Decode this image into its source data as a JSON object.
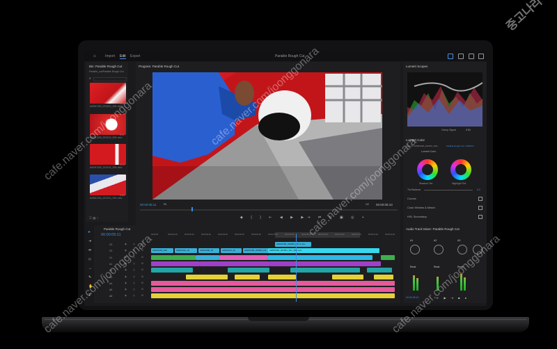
{
  "app": {
    "title": "Parable Rough Cut",
    "tabs": [
      {
        "label": "Import",
        "active": false
      },
      {
        "label": "Edit",
        "active": true
      },
      {
        "label": "Export",
        "active": false
      }
    ]
  },
  "bin": {
    "title": "Bin: Parable Rough Cut",
    "breadcrumb": "Parable_cut/Parable Rough Cut",
    "items": [
      {
        "name": "A005C020_22102X_S01.mov",
        "duration": "4:21"
      },
      {
        "name": "A005C009_22101X_S01.mov",
        "duration": "3:11"
      },
      {
        "name": "A004C026_22101X_S01.mov",
        "duration": "4:19"
      },
      {
        "name": "A005C016_22101X_S01.mov",
        "duration": "4:04"
      }
    ]
  },
  "program": {
    "title": "Program: Parable Rough Cut",
    "timecode_current": "00:00:05:11",
    "fit": "Fit",
    "resolution": "1/2",
    "timecode_total": "00:00:05:10"
  },
  "lumetri_scopes": {
    "title": "Lumetri Scopes",
    "clamp_signal": "Clamp Signal",
    "bits": "8 Bit"
  },
  "lumetri_color": {
    "title": "Lumetri Color",
    "source": "Source • A005C020_22101X_S01...",
    "target": "Parable Rough Cut • A005C0...",
    "fx_label": "Lumetri Color",
    "shadow_tint": "Shadow Tint",
    "highlight_tint": "Highlight Tint",
    "tint_balance": "Tint Balance",
    "tint_balance_value": "0.0",
    "sections": [
      {
        "label": "Curves",
        "checked": true
      },
      {
        "label": "Color Wheels & Match",
        "checked": true
      },
      {
        "label": "HSL Secondary",
        "checked": true
      }
    ]
  },
  "timeline": {
    "title": "Parable Rough Cut",
    "timecode": "00:00:05:11",
    "ruler": [
      "00:00:00",
      "00:00:01:00",
      "00:00:02:00",
      "00:00:03:00",
      "00:00:04:00",
      "00:00:05:00",
      "00:00:06:00",
      "00:00:07:00",
      "00:00:08:00",
      "00:00:09:00",
      "00:00:10:00",
      "00:00:11:00",
      "00:00:12:00",
      "00:00:13:00",
      "00:00:14:00"
    ],
    "tracks": [
      "V3",
      "V2",
      "V1",
      "A1",
      "A2",
      "A3",
      "A4",
      "A5",
      "A6"
    ],
    "clip_labels": [
      "A004C003_220",
      "A002C010_22",
      "A003C006_22",
      "A003C011_22",
      "A003C008_220901_R1...M.mov",
      "A005C020_221001_S01_S01.mov",
      "A002C005_220905_R1Y1.mov"
    ]
  },
  "mixer": {
    "title": "Audio Track Mixer: Parable Rough Cut",
    "channels": [
      "A1",
      "A2",
      "A3"
    ],
    "modes": [
      "Read",
      "Read",
      "Read"
    ],
    "timecode": "00:00:05:10"
  },
  "watermarks": [
    "cafe.naver.com/joonggonara",
    "cafe.naver.com/joonggonara",
    "cafe.naver.com/joonggonara",
    "cafe.naver.com/joonggonara",
    "cafe.naver.com/joonggonara",
    "중고나라"
  ],
  "colors": {
    "accent": "#3d8fe0",
    "clip_blue": "#3ab0d8",
    "clip_green": "#3fae4e",
    "clip_pink": "#e060b8",
    "clip_purple": "#a040c8",
    "clip_yellow": "#e4d13a",
    "clip_teal": "#22a6a6"
  }
}
